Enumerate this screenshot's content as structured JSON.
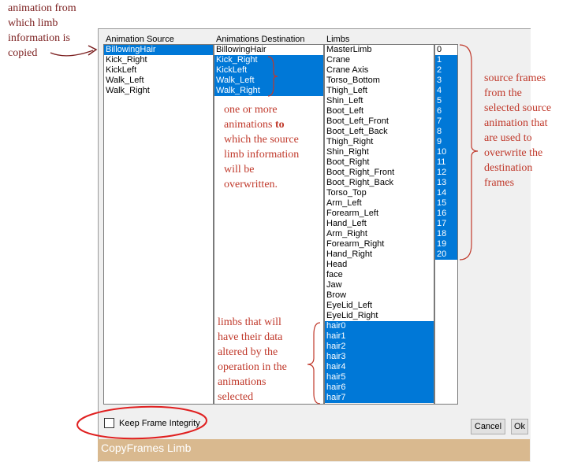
{
  "headers": {
    "source": "Animation Source",
    "destination": "Animations Destination",
    "limbs": "Limbs"
  },
  "source_list": [
    {
      "label": "BillowingHair",
      "selected": true
    },
    {
      "label": "Kick_Right",
      "selected": false
    },
    {
      "label": "KickLeft",
      "selected": false
    },
    {
      "label": "Walk_Left",
      "selected": false
    },
    {
      "label": "Walk_Right",
      "selected": false
    }
  ],
  "destination_list": [
    {
      "label": "BillowingHair",
      "selected": false
    },
    {
      "label": "Kick_Right",
      "selected": true
    },
    {
      "label": "KickLeft",
      "selected": true
    },
    {
      "label": "Walk_Left",
      "selected": true
    },
    {
      "label": "Walk_Right",
      "selected": true
    }
  ],
  "limbs_list": [
    {
      "label": "MasterLimb",
      "selected": false
    },
    {
      "label": "Crane",
      "selected": false
    },
    {
      "label": "Crane Axis",
      "selected": false
    },
    {
      "label": "Torso_Bottom",
      "selected": false
    },
    {
      "label": "Thigh_Left",
      "selected": false
    },
    {
      "label": "Shin_Left",
      "selected": false
    },
    {
      "label": "Boot_Left",
      "selected": false
    },
    {
      "label": "Boot_Left_Front",
      "selected": false
    },
    {
      "label": "Boot_Left_Back",
      "selected": false
    },
    {
      "label": "Thigh_Right",
      "selected": false
    },
    {
      "label": "Shin_Right",
      "selected": false
    },
    {
      "label": "Boot_Right",
      "selected": false
    },
    {
      "label": "Boot_Right_Front",
      "selected": false
    },
    {
      "label": "Boot_Right_Back",
      "selected": false
    },
    {
      "label": "Torso_Top",
      "selected": false
    },
    {
      "label": "Arm_Left",
      "selected": false
    },
    {
      "label": "Forearm_Left",
      "selected": false
    },
    {
      "label": "Hand_Left",
      "selected": false
    },
    {
      "label": "Arm_Right",
      "selected": false
    },
    {
      "label": "Forearm_Right",
      "selected": false
    },
    {
      "label": "Hand_Right",
      "selected": false
    },
    {
      "label": "Head",
      "selected": false
    },
    {
      "label": "face",
      "selected": false
    },
    {
      "label": "Jaw",
      "selected": false
    },
    {
      "label": "Brow",
      "selected": false
    },
    {
      "label": "EyeLid_Left",
      "selected": false
    },
    {
      "label": "EyeLid_Right",
      "selected": false
    },
    {
      "label": "hair0",
      "selected": true
    },
    {
      "label": "hair1",
      "selected": true
    },
    {
      "label": "hair2",
      "selected": true
    },
    {
      "label": "hair3",
      "selected": true
    },
    {
      "label": "hair4",
      "selected": true
    },
    {
      "label": "hair5",
      "selected": true
    },
    {
      "label": "hair6",
      "selected": true
    },
    {
      "label": "hair7",
      "selected": true
    }
  ],
  "frames_list": [
    {
      "label": "0",
      "selected": false
    },
    {
      "label": "1",
      "selected": true
    },
    {
      "label": "2",
      "selected": true
    },
    {
      "label": "3",
      "selected": true
    },
    {
      "label": "4",
      "selected": true
    },
    {
      "label": "5",
      "selected": true
    },
    {
      "label": "6",
      "selected": true
    },
    {
      "label": "7",
      "selected": true
    },
    {
      "label": "8",
      "selected": true
    },
    {
      "label": "9",
      "selected": true
    },
    {
      "label": "10",
      "selected": true
    },
    {
      "label": "11",
      "selected": true
    },
    {
      "label": "12",
      "selected": true
    },
    {
      "label": "13",
      "selected": true
    },
    {
      "label": "14",
      "selected": true
    },
    {
      "label": "15",
      "selected": true
    },
    {
      "label": "16",
      "selected": true
    },
    {
      "label": "17",
      "selected": true
    },
    {
      "label": "18",
      "selected": true
    },
    {
      "label": "19",
      "selected": true
    },
    {
      "label": "20",
      "selected": true
    }
  ],
  "checkbox": {
    "label": "Keep Frame Integrity",
    "checked": false
  },
  "buttons": {
    "cancel": "Cancel",
    "ok": "Ok"
  },
  "window_title": "CopyFrames Limb",
  "annotations": {
    "source": [
      "animation from",
      "which limb",
      "information is",
      "copied"
    ],
    "destination_lines": [
      "one or more",
      "animations ",
      "which the source",
      "limb information",
      "will be",
      "overwritten."
    ],
    "destination_bold": "to",
    "frames": [
      "source frames",
      "from the",
      "selected source",
      "animation that",
      "are used to",
      "overwrite the",
      "destination",
      "frames"
    ],
    "limbs": [
      "limbs that will",
      "have their data",
      "altered by the",
      "operation in the",
      "animations",
      "selected"
    ]
  },
  "colors": {
    "selection": "#0078d7",
    "annotation": "#c0392b",
    "annotation_dark": "#7b1f1f",
    "titlebar": "#d9b98f"
  }
}
